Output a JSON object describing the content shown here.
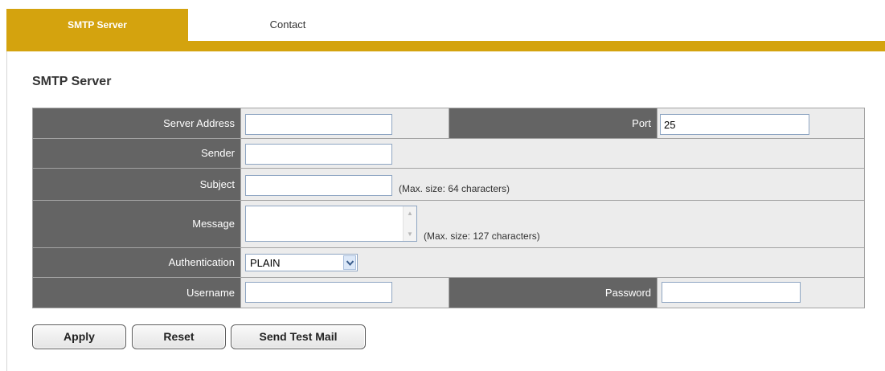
{
  "tabs": [
    {
      "label": "SMTP Server",
      "active": true
    },
    {
      "label": "Contact",
      "active": false
    }
  ],
  "section_title": "SMTP Server",
  "form": {
    "server_address": {
      "label": "Server Address",
      "value": ""
    },
    "port": {
      "label": "Port",
      "value": "25"
    },
    "sender": {
      "label": "Sender",
      "value": ""
    },
    "subject": {
      "label": "Subject",
      "value": "",
      "hint": "(Max. size: 64 characters)"
    },
    "message": {
      "label": "Message",
      "value": "",
      "hint": "(Max. size: 127 characters)"
    },
    "authentication": {
      "label": "Authentication",
      "selected": "PLAIN"
    },
    "username": {
      "label": "Username",
      "value": ""
    },
    "password": {
      "label": "Password",
      "value": ""
    }
  },
  "buttons": {
    "apply": "Apply",
    "reset": "Reset",
    "send_test_mail": "Send Test Mail"
  },
  "colors": {
    "accent": "#d4a30e",
    "label_bg": "#646464",
    "value_bg": "#ececec",
    "grid": "#a3a3a3"
  },
  "icons": {
    "select_arrow": "chevron-down-icon",
    "scroll_up": "scroll-up-icon",
    "scroll_down": "scroll-down-icon"
  }
}
